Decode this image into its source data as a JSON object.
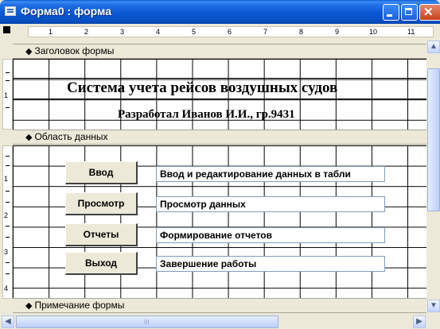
{
  "window": {
    "title": "Форма0 : форма"
  },
  "ruler": {
    "marks": [
      "1",
      "2",
      "3",
      "4",
      "5",
      "6",
      "7",
      "8",
      "9",
      "10",
      "11"
    ]
  },
  "vruler": {
    "header_marks": [
      "1"
    ],
    "detail_marks": [
      "1",
      "2",
      "3",
      "4"
    ]
  },
  "sections": {
    "header": "Заголовок формы",
    "detail": "Область данных",
    "footer": "Примечание формы"
  },
  "header_content": {
    "title": "Система учета рейсов воздушных судов",
    "subtitle": "Разработал Иванов И.И., гр.9431"
  },
  "buttons": [
    {
      "label": "Ввод",
      "description": "Ввод и редактирование данных в табли"
    },
    {
      "label": "Просмотр",
      "description": "Просмотр данных"
    },
    {
      "label": "Отчеты",
      "description": "Формирование отчетов"
    },
    {
      "label": "Выход",
      "description": "Завершение работы"
    }
  ],
  "scroll": {
    "h_thumb_grip": "III"
  },
  "colors": {
    "titlebar": "#0a5fd8",
    "surface": "#ece9d8"
  }
}
